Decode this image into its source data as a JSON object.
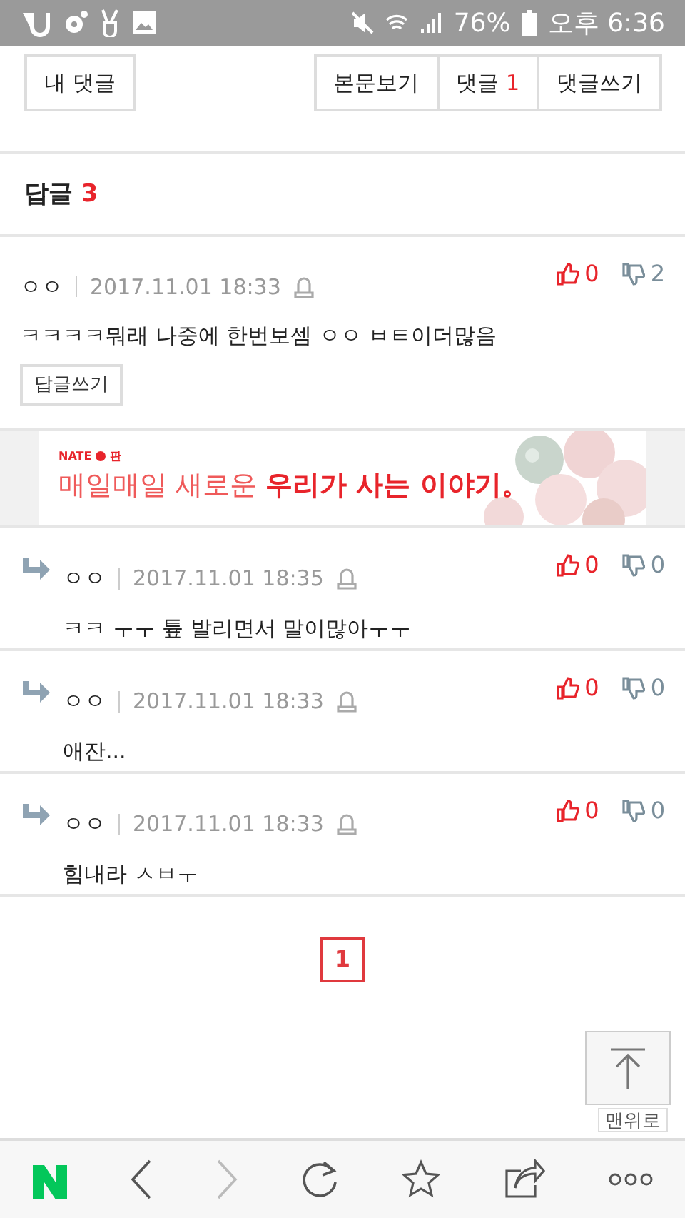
{
  "status_bar": {
    "battery": "76%",
    "time": "오후 6:36"
  },
  "top_nav": {
    "my_comments": "내 댓글",
    "tabs": [
      {
        "label": "본문보기"
      },
      {
        "label": "댓글",
        "count": "1"
      },
      {
        "label": "댓글쓰기"
      }
    ]
  },
  "replies_header": {
    "label": "답글",
    "count": "3"
  },
  "comments": [
    {
      "kind": "comment",
      "author": "ㅇㅇ",
      "date": "2017.11.01 18:33",
      "text": "ㅋㅋㅋㅋ뭐래 나중에 한번보셈 ㅇㅇ ㅂㅌ이더많음",
      "likes": "0",
      "dislikes": "2",
      "reply_button": "답글쓰기"
    },
    {
      "kind": "ad",
      "brand": "NATE",
      "brand_sub": "판",
      "headline": "매일매일 새로운",
      "headline_strong": "우리가 사는 이야기。"
    },
    {
      "kind": "reply",
      "author": "ㅇㅇ",
      "date": "2017.11.01 18:35",
      "text": "ㅋㅋ ㅜㅜ 튶 발리면서 말이많아ㅜㅜ",
      "likes": "0",
      "dislikes": "0"
    },
    {
      "kind": "reply",
      "author": "ㅇㅇ",
      "date": "2017.11.01 18:33",
      "text": "애잔...",
      "likes": "0",
      "dislikes": "0"
    },
    {
      "kind": "reply",
      "author": "ㅇㅇ",
      "date": "2017.11.01 18:33",
      "text": "힘내라 ㅅㅂㅜ",
      "likes": "0",
      "dislikes": "0"
    }
  ],
  "pagination": [
    {
      "label": "1",
      "selected": true
    }
  ],
  "top_button": {
    "label": "맨위로"
  },
  "toolbar": {
    "forward_disabled": true
  }
}
